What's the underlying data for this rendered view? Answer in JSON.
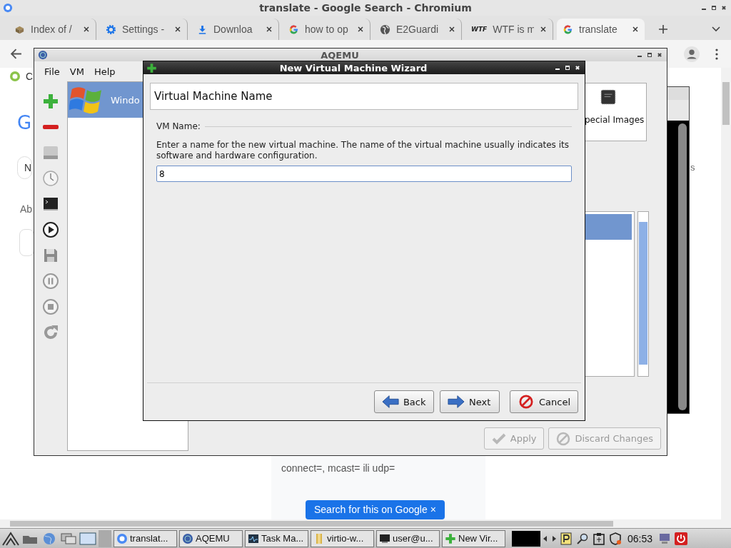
{
  "browser": {
    "title": "translate - Google Search - Chromium",
    "tabs": [
      {
        "label": "Index of /",
        "selected": false
      },
      {
        "label": "Settings -",
        "selected": false
      },
      {
        "label": "Downloa",
        "selected": false
      },
      {
        "label": "how to op",
        "selected": false
      },
      {
        "label": "E2Guardi",
        "selected": false
      },
      {
        "label": "WTF is m",
        "favicon_text": "WTF",
        "selected": false
      },
      {
        "label": "translate",
        "selected": true
      }
    ]
  },
  "page": {
    "bookmark_fragment": "C",
    "logo_fragment": "G",
    "chip_fragment": "N",
    "about_fragment": "Ab",
    "right_fragment": "s",
    "snippet": "connect=, mcast= ili udp=",
    "search_button": "Search for this on Google ×"
  },
  "aqemu": {
    "title": "AQEMU",
    "menu": [
      "File",
      "VM",
      "Help"
    ],
    "vms": [
      {
        "name": "Windo",
        "selected": true
      }
    ],
    "special_images": "pecial Images",
    "apply": {
      "label": "Apply",
      "disabled": true
    },
    "discard": {
      "label": "Discard Changes",
      "disabled": true
    }
  },
  "wizard": {
    "title": "New Virtual Machine Wizard",
    "heading": "Virtual Machine Name",
    "field_label": "VM Name:",
    "description": "Enter a name for the new virtual machine. The name of the virtual machine usually indicates its software and hardware configuration.",
    "vm_name": "8",
    "buttons": [
      {
        "label": "Back",
        "kind": "back"
      },
      {
        "label": "Next",
        "kind": "next"
      },
      {
        "label": "Cancel",
        "kind": "cancel"
      }
    ]
  },
  "taskbar": {
    "tasks": [
      {
        "label": "translat..."
      },
      {
        "label": "AQEMU"
      },
      {
        "label": "Task Ma..."
      },
      {
        "label": "virtio-w..."
      },
      {
        "label": "user@u..."
      },
      {
        "label": "New Vir..."
      }
    ],
    "clock": "06:53"
  }
}
